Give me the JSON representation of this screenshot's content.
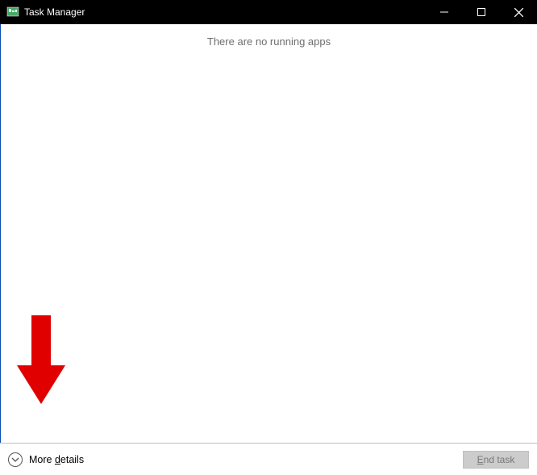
{
  "window": {
    "title": "Task Manager"
  },
  "content": {
    "empty_message": "There are no running apps"
  },
  "footer": {
    "more_details_label": "More details",
    "end_task_label": "End task"
  }
}
